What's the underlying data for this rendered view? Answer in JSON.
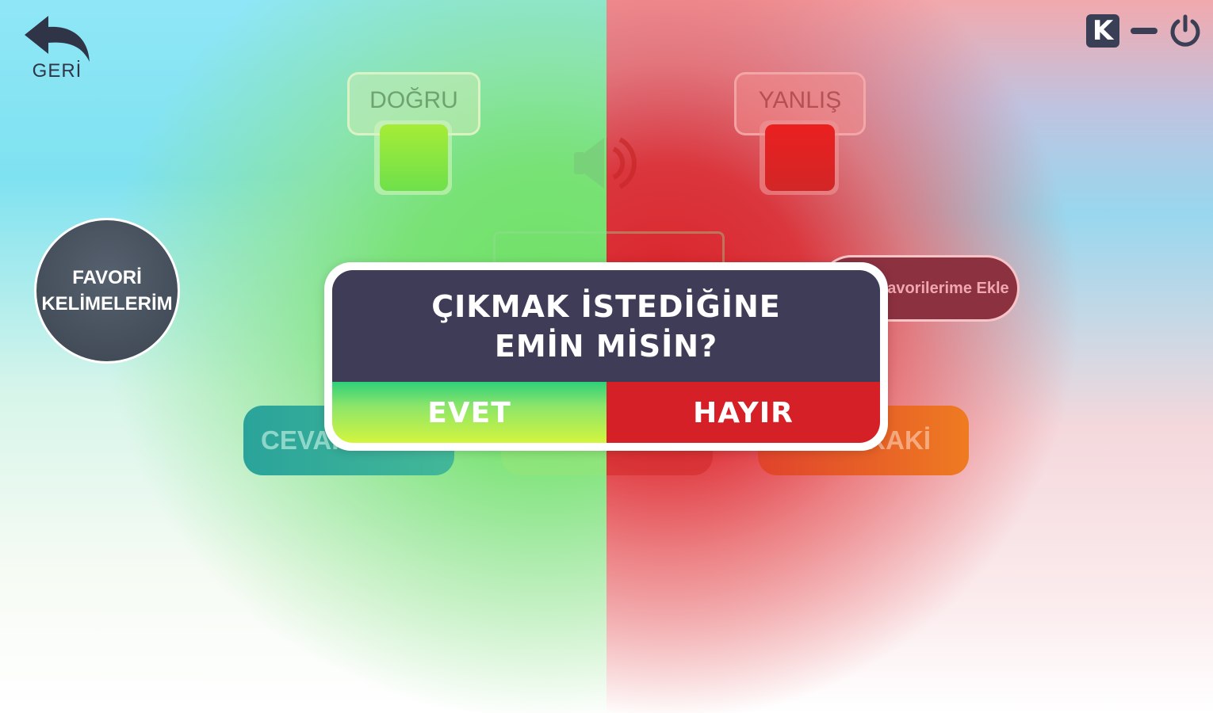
{
  "header": {
    "back_label": "GERİ",
    "k_label": "K"
  },
  "game": {
    "correct_label": "DOĞRU",
    "wrong_label": "YANLIŞ",
    "favorites_label_line1": "FAVORİ",
    "favorites_label_line2": "KELİMELERİM",
    "add_favorite_label": "Favorilerime Ekle",
    "answer_button_label": "CEVAP",
    "next_button_label": "SONRAKİ"
  },
  "dialog": {
    "question_line1": "ÇIKMAK İSTEDİĞİNE",
    "question_line2": "EMİN MİSİN?",
    "yes_label": "EVET",
    "no_label": "HAYIR"
  },
  "colors": {
    "correct_green": "#6ee04c",
    "wrong_red": "#d62027",
    "dialog_bg": "#3e3c57",
    "icon_dark": "#3b3f55"
  }
}
